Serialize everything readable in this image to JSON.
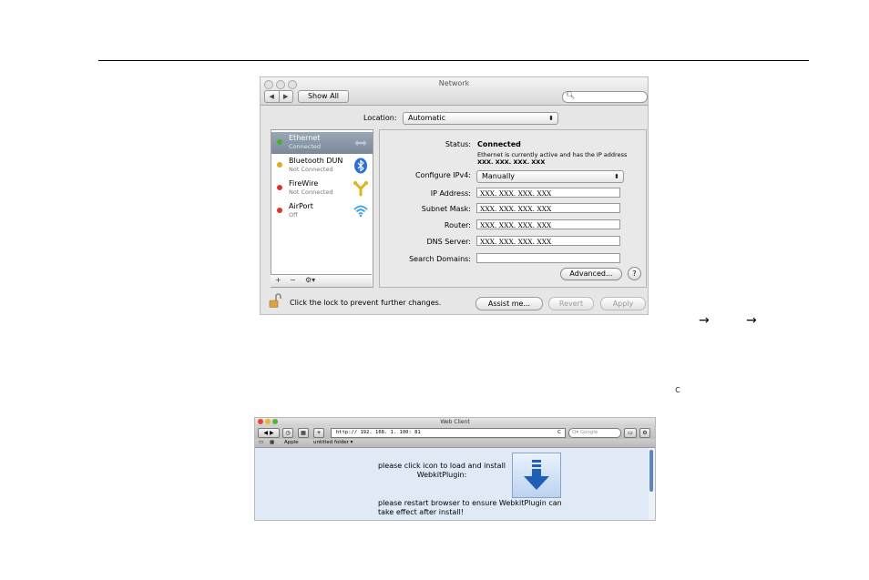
{
  "network": {
    "title": "Network",
    "show_all": "Show All",
    "location_label": "Location:",
    "location_value": "Automatic",
    "services": [
      {
        "name": "Ethernet",
        "status": "Connected",
        "dot_color": "#4caf2a"
      },
      {
        "name": "Bluetooth DUN",
        "status": "Not Connected",
        "dot_color": "#e6a817"
      },
      {
        "name": "FireWire",
        "status": "Not Connected",
        "dot_color": "#d9332b"
      },
      {
        "name": "AirPort",
        "status": "Off",
        "dot_color": "#d9332b"
      }
    ],
    "list_buttons": {
      "add": "+",
      "remove": "−",
      "action": "⚙▾"
    },
    "status_label": "Status:",
    "status_value": "Connected",
    "status_desc_prefix": "Ethernet is currently active and has the IP address",
    "status_desc_ip": "XXX. XXX. XXX. XXX",
    "configure_label": "Configure IPv4:",
    "configure_value": "Manually",
    "ip_label": "IP Address:",
    "ip_value": "XXX. XXX. XXX. XXX",
    "subnet_label": "Subnet Mask:",
    "subnet_value": "XXX. XXX. XXX. XXX",
    "router_label": "Router:",
    "router_value": "XXX. XXX. XXX. XXX",
    "dns_label": "DNS Server:",
    "dns_value": " XXX. XXX. XXX. XXX",
    "search_label": "Search Domains:",
    "search_value": "",
    "advanced": "Advanced...",
    "help": "?",
    "lock_text": "Click the lock to prevent further changes.",
    "assist": "Assist me...",
    "revert": "Revert",
    "apply": "Apply"
  },
  "doc": {
    "arrow1": "→",
    "arrow2": "→",
    "refresh_glyph": "c"
  },
  "web": {
    "title": "Web Client",
    "url": "http:// 192. 168. 1. 100: 81",
    "reload": "C",
    "search_placeholder": "Q▾ Google",
    "bookmarks": [
      "Apple",
      "untitled folder ▾"
    ],
    "message1": "please click icon to load and install WebkitPlugin:",
    "message2": "please restart browser to ensure WebkitPlugin can take effect after install!"
  }
}
